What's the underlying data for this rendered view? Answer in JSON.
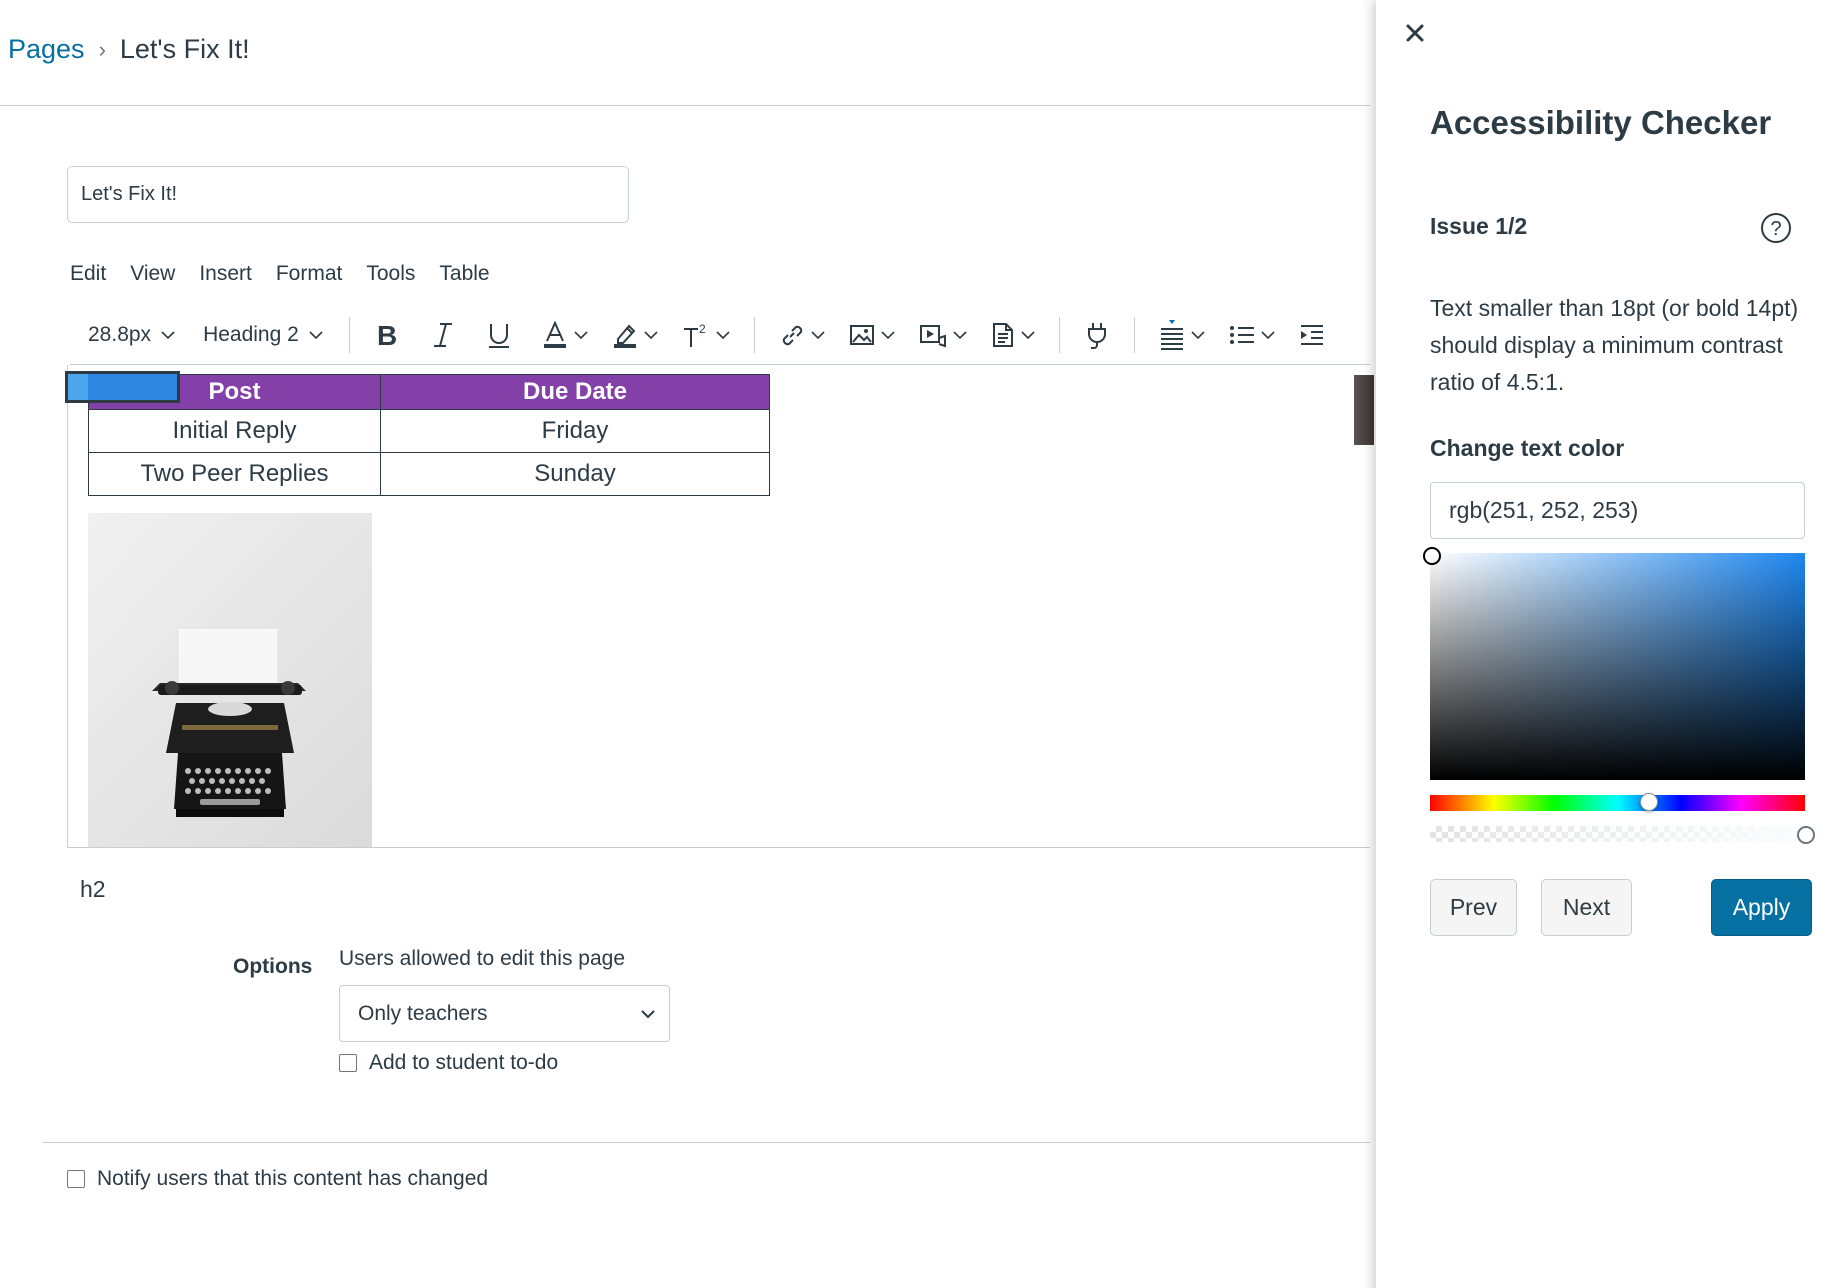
{
  "breadcrumb": {
    "root": "Pages",
    "separator": "›",
    "current": "Let's Fix It!"
  },
  "editor": {
    "title_value": "Let's Fix It!",
    "menu": [
      "Edit",
      "View",
      "Insert",
      "Format",
      "Tools",
      "Table"
    ],
    "toolbar": {
      "font_size": "28.8px",
      "block_format": "Heading 2",
      "icons": [
        "bold-icon",
        "italic-icon",
        "underline-icon",
        "text-color-icon",
        "highlight-icon",
        "superscript-icon",
        "link-icon",
        "image-icon",
        "media-icon",
        "document-icon",
        "plugin-icon",
        "align-icon",
        "list-icon",
        "indent-icon"
      ]
    },
    "table": {
      "headers": [
        "Post",
        "Due Date"
      ],
      "rows": [
        [
          "Initial Reply",
          "Friday"
        ],
        [
          "Two Peer Replies",
          "Sunday"
        ]
      ],
      "header_color": "#8240a8"
    },
    "path": "h2"
  },
  "options": {
    "label": "Options",
    "users_label": "Users allowed to edit this page",
    "users_selected": "Only teachers",
    "todo_label": "Add to student to-do"
  },
  "notify_label": "Notify users that this content has changed",
  "checker": {
    "title": "Accessibility Checker",
    "issue": "Issue 1/2",
    "description": "Text smaller than 18pt (or bold 14pt) should display a minimum contrast ratio of 4.5:1.",
    "change_label": "Change text color",
    "color_value": "rgb(251, 252, 253)",
    "prev_label": "Prev",
    "next_label": "Next",
    "apply_label": "Apply",
    "accent_color": "#0770a3"
  }
}
